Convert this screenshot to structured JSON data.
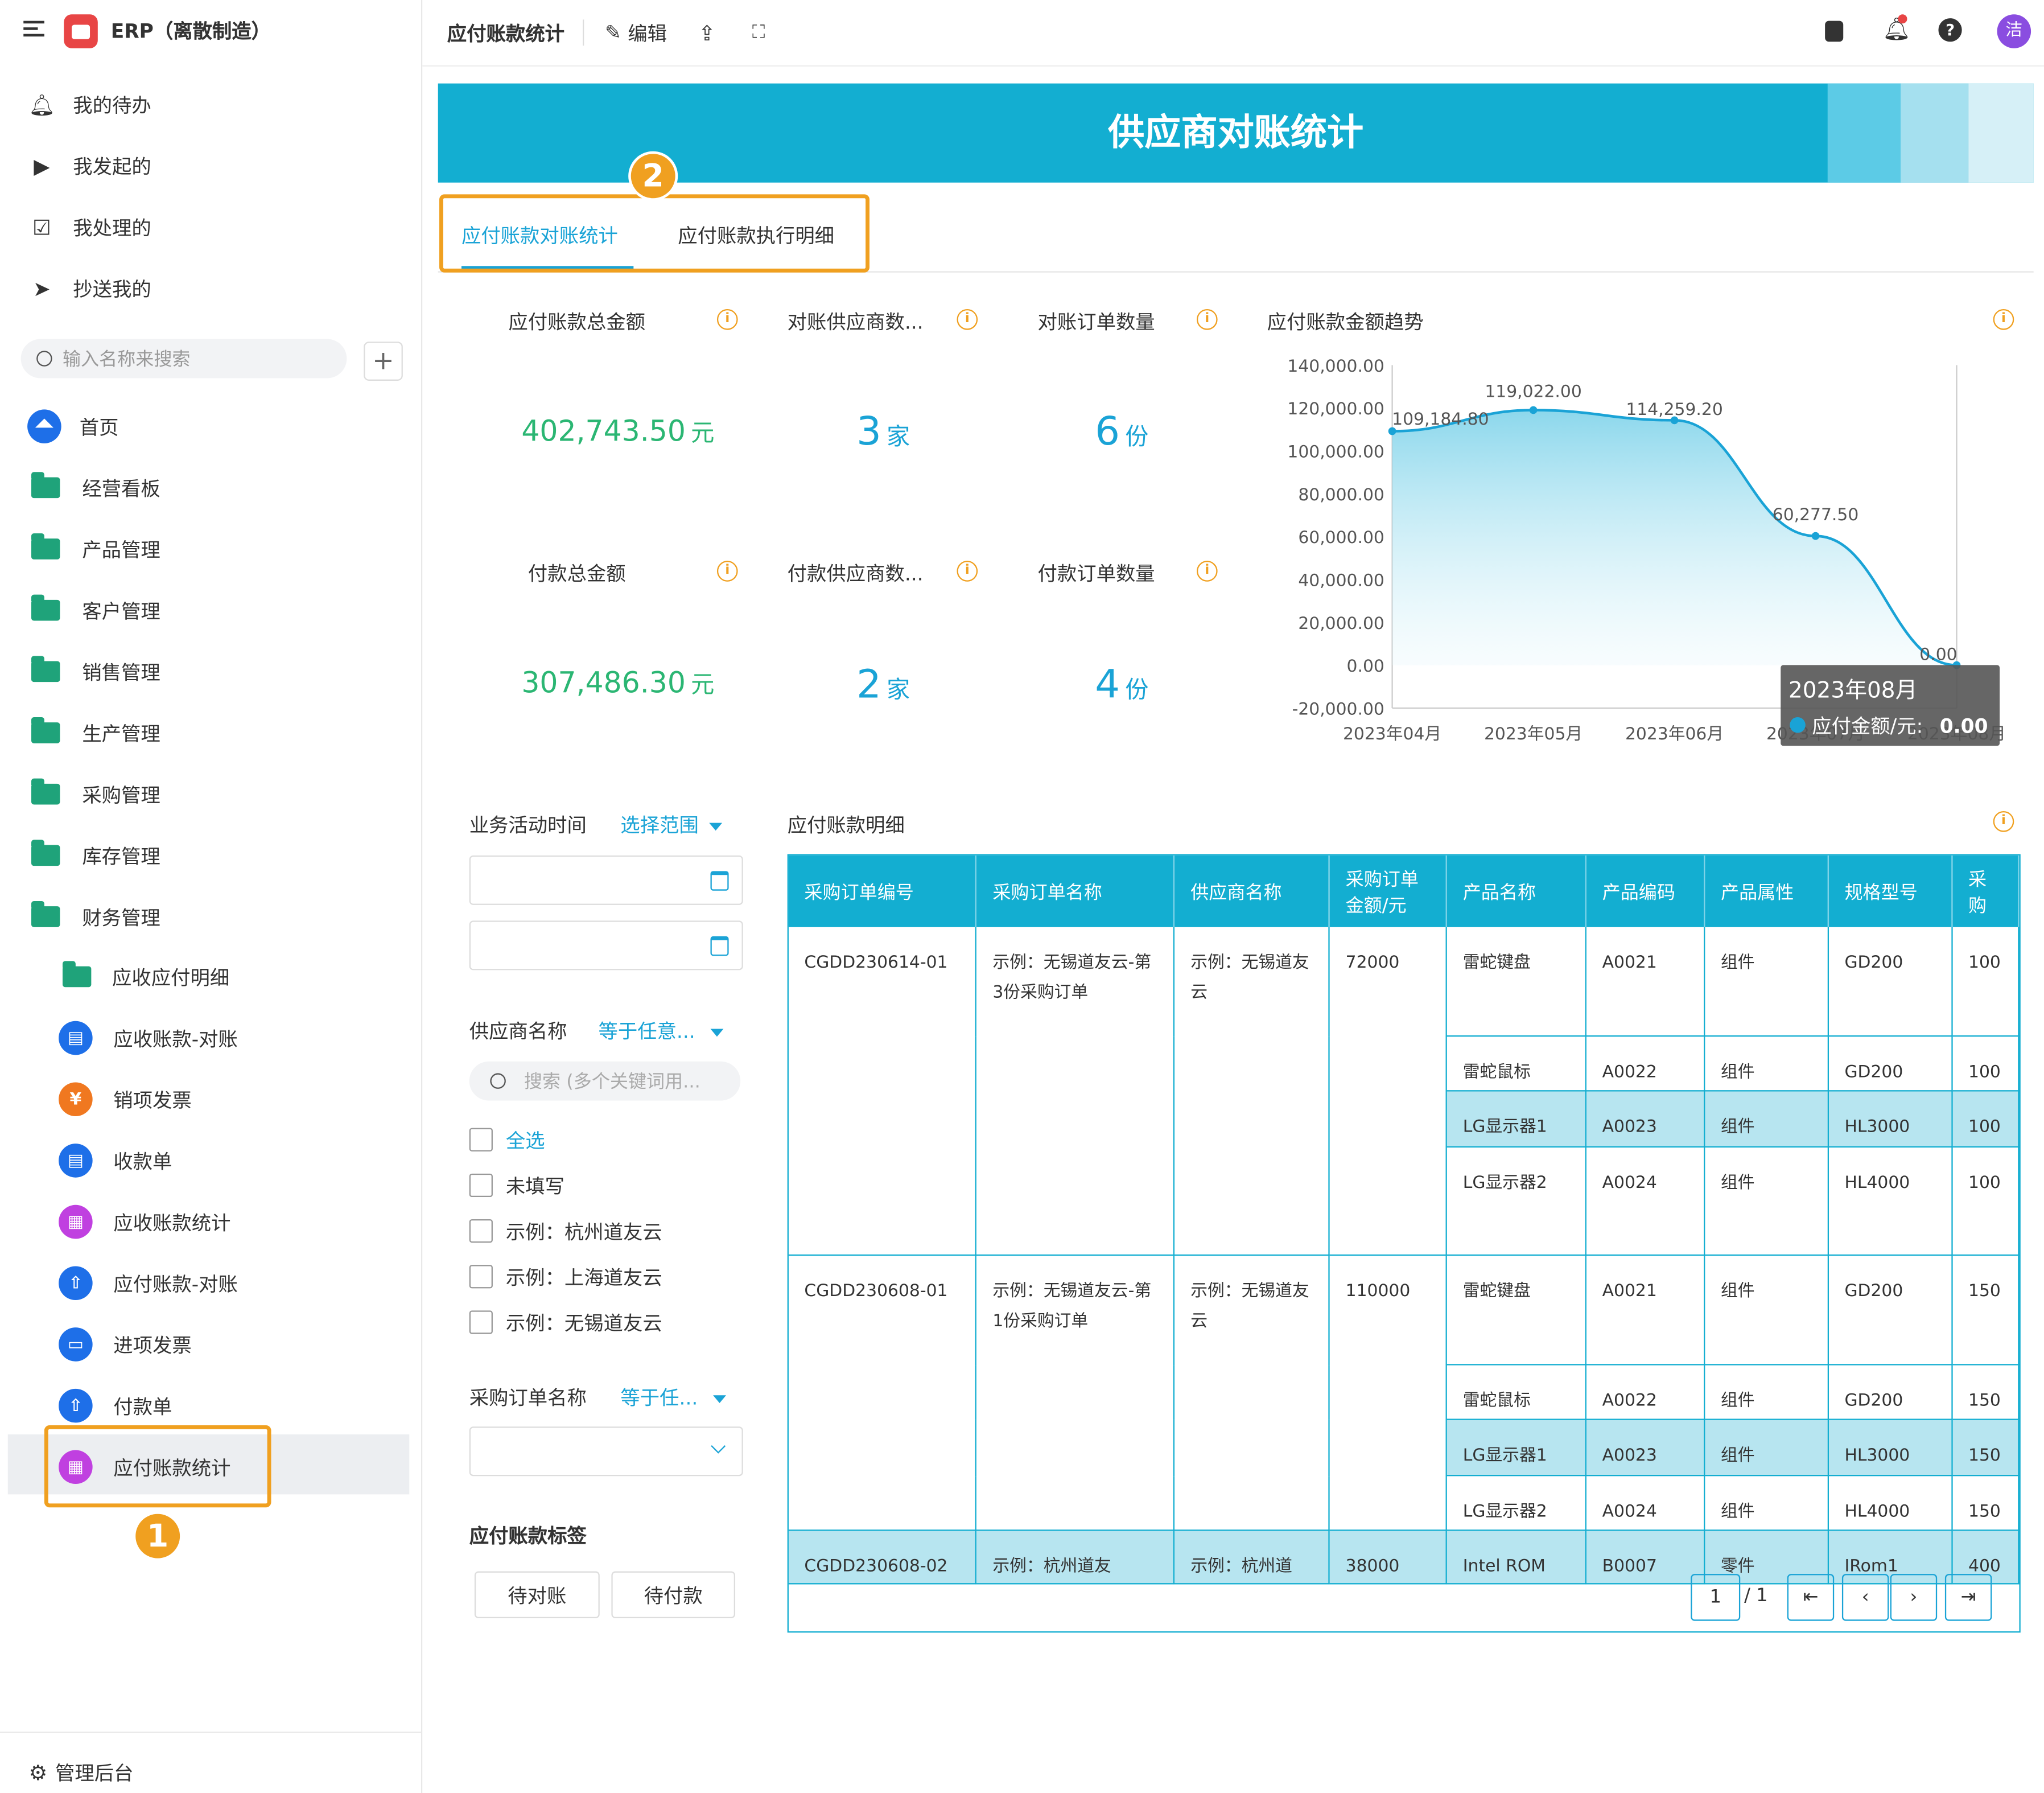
{
  "topbar": {
    "app_name": "ERP（离散制造）",
    "page_title": "应付账款统计",
    "edit_label": "编辑",
    "avatar_text": "洁"
  },
  "sidebar": {
    "quick": [
      {
        "label": "我的待办",
        "icon": "bell-icon"
      },
      {
        "label": "我发起的",
        "icon": "play-circle-icon"
      },
      {
        "label": "我处理的",
        "icon": "check-box-icon"
      },
      {
        "label": "抄送我的",
        "icon": "send-icon"
      }
    ],
    "search_placeholder": "输入名称来搜索",
    "home_label": "首页",
    "folders": [
      "经营看板",
      "产品管理",
      "客户管理",
      "销售管理",
      "生产管理",
      "采购管理",
      "库存管理",
      "财务管理"
    ],
    "finance_items": [
      {
        "label": "应收应付明细",
        "icon": "folder-icon"
      },
      {
        "label": "应收账款-对账",
        "icon": "form-icon"
      },
      {
        "label": "销项发票",
        "icon": "invoice-icon"
      },
      {
        "label": "收款单",
        "icon": "form-icon"
      },
      {
        "label": "应收账款统计",
        "icon": "chart-icon"
      },
      {
        "label": "应付账款-对账",
        "icon": "upload-icon"
      },
      {
        "label": "进项发票",
        "icon": "card-icon"
      },
      {
        "label": "付款单",
        "icon": "upload-icon"
      },
      {
        "label": "应付账款统计",
        "icon": "chart-icon"
      }
    ],
    "admin_label": "管理后台"
  },
  "markers": {
    "one": "1",
    "two": "2"
  },
  "banner": {
    "title": "供应商对账统计"
  },
  "tabs": [
    {
      "label": "应付账款对账统计",
      "active": true
    },
    {
      "label": "应付账款执行明细",
      "active": false
    }
  ],
  "kpis": [
    {
      "label": "应付账款总金额",
      "value": "402,743.50",
      "unit": "元",
      "color": "#2bb673"
    },
    {
      "label": "对账供应商数...",
      "value": "3",
      "unit": "家",
      "color": "#1aa3d6"
    },
    {
      "label": "对账订单数量",
      "value": "6",
      "unit": "份",
      "color": "#1aa3d6"
    },
    {
      "label": "付款总金额",
      "value": "307,486.30",
      "unit": "元",
      "color": "#2bb673"
    },
    {
      "label": "付款供应商数...",
      "value": "2",
      "unit": "家",
      "color": "#1aa3d6"
    },
    {
      "label": "付款订单数量",
      "value": "4",
      "unit": "份",
      "color": "#1aa3d6"
    }
  ],
  "chart_data": {
    "type": "area",
    "title": "应付账款金额趋势",
    "x": [
      "2023年04月",
      "2023年05月",
      "2023年06月",
      "2023年07月",
      "2023年08月"
    ],
    "series": [
      {
        "name": "应付金额/元",
        "values": [
          109184.8,
          119022.0,
          114259.2,
          60277.5,
          0.0
        ]
      }
    ],
    "data_labels": [
      "109,184.80",
      "119,022.00",
      "114,259.20",
      "60,277.50",
      "0.00"
    ],
    "y_ticks": [
      "140,000.00",
      "120,000.00",
      "100,000.00",
      "80,000.00",
      "60,000.00",
      "40,000.00",
      "20,000.00",
      "0.00",
      "-20,000.00"
    ],
    "ylim": [
      -20000,
      140000
    ],
    "grid": false,
    "tooltip": {
      "title": "2023年08月",
      "series_label": "应付金额/元:",
      "value": "0.00"
    },
    "color": "#1aa3d6"
  },
  "filters": {
    "time_label": "业务活动时间",
    "time_range_link": "选择范围",
    "supplier_label": "供应商名称",
    "supplier_op": "等于任意...",
    "supplier_search_placeholder": "搜索 (多个关键词用...",
    "options": [
      "全选",
      "未填写",
      "示例：杭州道友云",
      "示例：上海道友云",
      "示例：无锡道友云"
    ],
    "order_name_label": "采购订单名称",
    "order_name_op": "等于任...",
    "tags_label": "应付账款标签",
    "tag_buttons": [
      "待对账",
      "待付款"
    ]
  },
  "detail": {
    "title": "应付账款明细",
    "headers": [
      "采购订单编号",
      "采购订单名称",
      "供应商名称",
      "采购订单金额/元",
      "产品名称",
      "产品编码",
      "产品属性",
      "规格型号",
      "采购"
    ],
    "orders": [
      {
        "no": "CGDD230614-01",
        "name": "示例：无锡道友云-第3份采购订单",
        "supplier": "示例：无锡道友云",
        "amount": "72000",
        "items": [
          {
            "product": "雷蛇键盘",
            "code": "A0021",
            "attr": "组件",
            "spec": "GD200",
            "qty": "100"
          },
          {
            "product": "雷蛇鼠标",
            "code": "A0022",
            "attr": "组件",
            "spec": "GD200",
            "qty": "100"
          },
          {
            "product": "LG显示器1",
            "code": "A0023",
            "attr": "组件",
            "spec": "HL3000",
            "qty": "100"
          },
          {
            "product": "LG显示器2",
            "code": "A0024",
            "attr": "组件",
            "spec": "HL4000",
            "qty": "100"
          }
        ]
      },
      {
        "no": "CGDD230608-01",
        "name": "示例：无锡道友云-第1份采购订单",
        "supplier": "示例：无锡道友云",
        "amount": "110000",
        "items": [
          {
            "product": "雷蛇键盘",
            "code": "A0021",
            "attr": "组件",
            "spec": "GD200",
            "qty": "150"
          },
          {
            "product": "雷蛇鼠标",
            "code": "A0022",
            "attr": "组件",
            "spec": "GD200",
            "qty": "150"
          },
          {
            "product": "LG显示器1",
            "code": "A0023",
            "attr": "组件",
            "spec": "HL3000",
            "qty": "150"
          },
          {
            "product": "LG显示器2",
            "code": "A0024",
            "attr": "组件",
            "spec": "HL4000",
            "qty": "150"
          }
        ]
      },
      {
        "no": "CGDD230608-02",
        "name": "示例：杭州道友",
        "supplier": "示例：杭州道",
        "amount": "38000",
        "items": [
          {
            "product": "Intel ROM",
            "code": "B0007",
            "attr": "零件",
            "spec": "IRom1",
            "qty": "400"
          }
        ]
      }
    ]
  },
  "pagination": {
    "current": "1",
    "total": "/ 1"
  }
}
